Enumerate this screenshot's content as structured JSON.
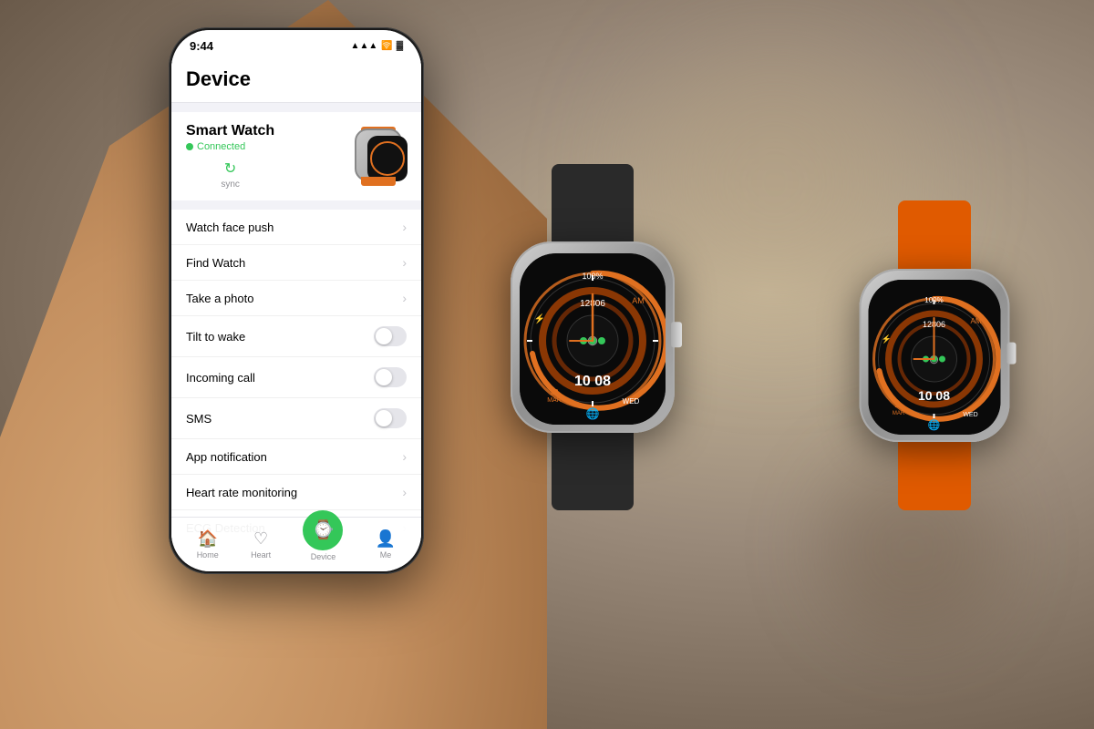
{
  "background": {
    "color": "#8a7a6a"
  },
  "phone": {
    "status_bar": {
      "time": "9:44",
      "icons": [
        "signal",
        "wifi",
        "battery"
      ]
    },
    "header": {
      "title": "Device"
    },
    "device_card": {
      "name": "Smart Watch",
      "status": "Connected",
      "sync_label": "sync"
    },
    "settings": [
      {
        "label": "Watch face push",
        "type": "chevron"
      },
      {
        "label": "Find Watch",
        "type": "chevron"
      },
      {
        "label": "Take a photo",
        "type": "chevron"
      },
      {
        "label": "Tilt to wake",
        "type": "toggle"
      },
      {
        "label": "Incoming call",
        "type": "toggle"
      },
      {
        "label": "SMS",
        "type": "toggle"
      },
      {
        "label": "App notification",
        "type": "chevron"
      },
      {
        "label": "Heart rate monitoring",
        "type": "chevron"
      },
      {
        "label": "ECG Detection",
        "type": "chevron"
      }
    ],
    "bottom_tabs": [
      {
        "label": "Home",
        "icon": "🏠",
        "active": false
      },
      {
        "label": "Heart",
        "icon": "❤️",
        "active": false
      },
      {
        "label": "Device",
        "icon": "⌚",
        "active": true,
        "special": true
      },
      {
        "label": "Me",
        "icon": "👤",
        "active": false
      }
    ]
  },
  "watches": {
    "left": {
      "battery": "100%",
      "time": "10 08",
      "date": "28 MAR",
      "day": "WED",
      "steps": "12806",
      "period": "AM",
      "band_color": "#2a2a2a"
    },
    "right": {
      "battery": "100%",
      "time": "10 08",
      "date": "28 MAR",
      "day": "WED",
      "steps": "12806",
      "period": "AM",
      "band_color": "#e05a00"
    }
  }
}
